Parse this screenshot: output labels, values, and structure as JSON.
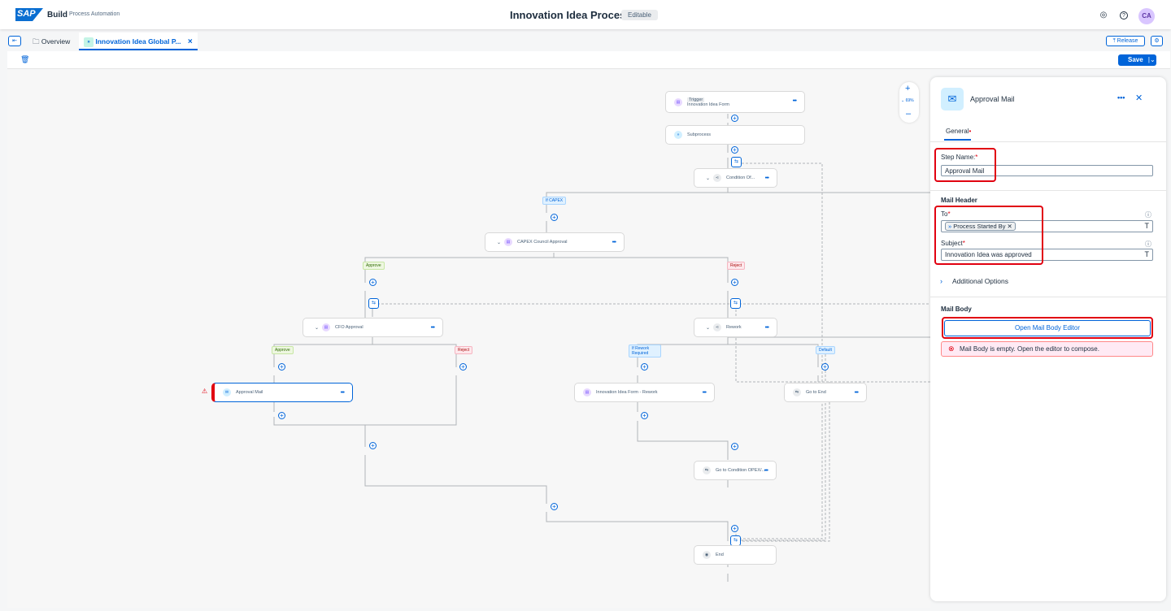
{
  "shell": {
    "logo": "SAP",
    "product": "Build",
    "product_sub": "Process Automation",
    "title": "Innovation Idea Process",
    "badge": "Editable",
    "avatar": "CA"
  },
  "tabs": {
    "overview": "Overview",
    "active": "Innovation Idea Global P...",
    "release": "Release",
    "save": "Save"
  },
  "zoom": {
    "level": "69%"
  },
  "nodes": {
    "trigger_tag": "Trigger",
    "trigger": "Innovation Idea Form",
    "subprocess": "Subprocess",
    "condition": "Condition Of...",
    "capex": "CAPEX Council Approval",
    "cfo": "CFO Approval",
    "rework": "Rework",
    "approval_mail": "Approval Mail",
    "rework_form": "Innovation Idea Form - Rework",
    "go_end": "Go to End",
    "go_cond": "Go to Condition OPEX/...",
    "end": "End"
  },
  "labels": {
    "if_capex": "If CAPEX",
    "approve1": "Approve",
    "reject1": "Reject",
    "approve2": "Approve",
    "reject2": "Reject",
    "rework_req": "If Rework Required",
    "default": "Default"
  },
  "panel": {
    "title": "Approval Mail",
    "tab": "General",
    "step_name_label": "Step Name:",
    "step_name": "Approval Mail",
    "mail_header": "Mail Header",
    "to_label": "To",
    "to_token": "Process Started By",
    "subject_label": "Subject",
    "subject": "Innovation Idea was approved",
    "additional": "Additional Options",
    "mail_body": "Mail Body",
    "open_editor": "Open Mail Body Editor",
    "error": "Mail Body is empty. Open the editor to compose."
  },
  "colors": {
    "accent": "#0064d9",
    "highlight": "#e10010"
  }
}
